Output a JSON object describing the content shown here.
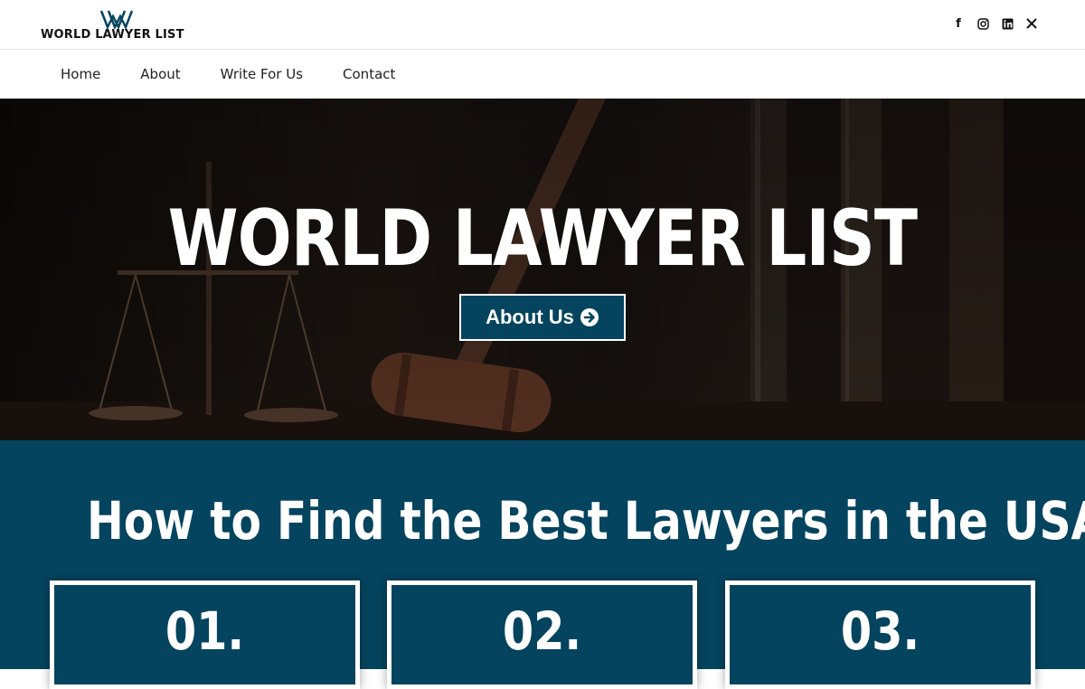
{
  "brand": {
    "name": "WORLD LAWYER LIST",
    "accent_color": "#05445e"
  },
  "socials": [
    {
      "icon": "facebook-icon",
      "glyph": "f"
    },
    {
      "icon": "instagram-icon",
      "glyph": ""
    },
    {
      "icon": "linkedin-icon",
      "glyph": ""
    },
    {
      "icon": "x-icon",
      "glyph": "𝕏"
    }
  ],
  "nav": {
    "items": [
      "Home",
      "About",
      "Write For Us",
      "Contact"
    ]
  },
  "hero": {
    "title": "WORLD LAWYER LIST",
    "button_label": "About Us"
  },
  "section": {
    "title": "How to Find the Best Lawyers in the USA",
    "cards": [
      "01.",
      "02.",
      "03."
    ]
  }
}
